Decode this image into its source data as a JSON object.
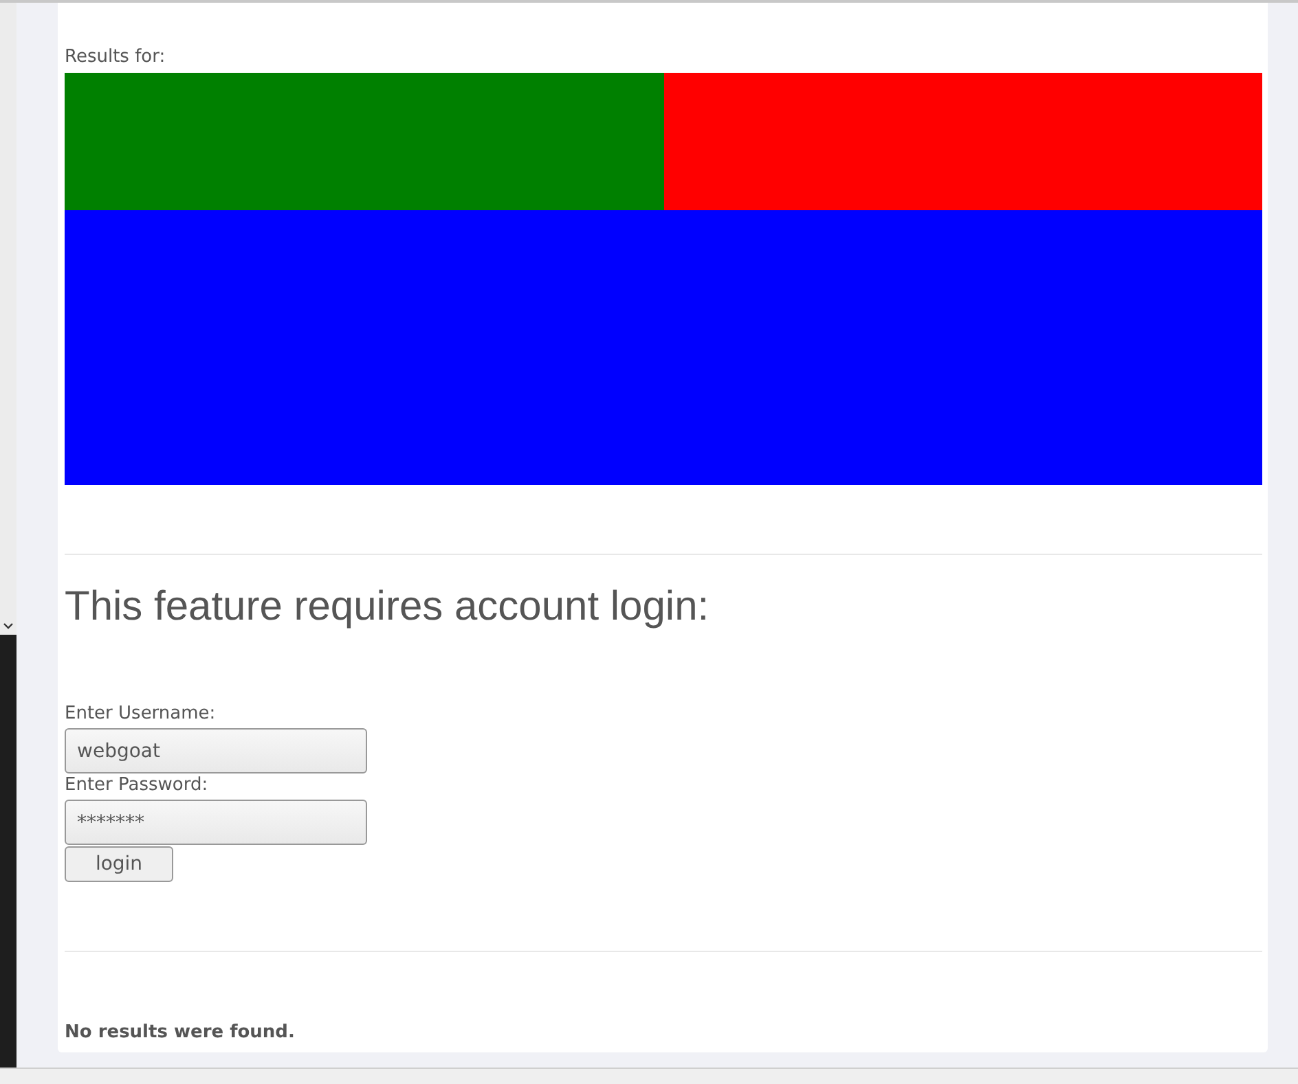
{
  "results_label": "Results for:",
  "blocks": [
    {
      "color": "#008000"
    },
    {
      "color": "#ff0000"
    },
    {
      "color": "#0000ff"
    }
  ],
  "heading": "This feature requires account login:",
  "fields": [
    {
      "label": "Enter Username:",
      "value": "webgoat"
    },
    {
      "label": "Enter Password:",
      "value": "*******"
    }
  ],
  "button": "login",
  "message": "No results were found."
}
